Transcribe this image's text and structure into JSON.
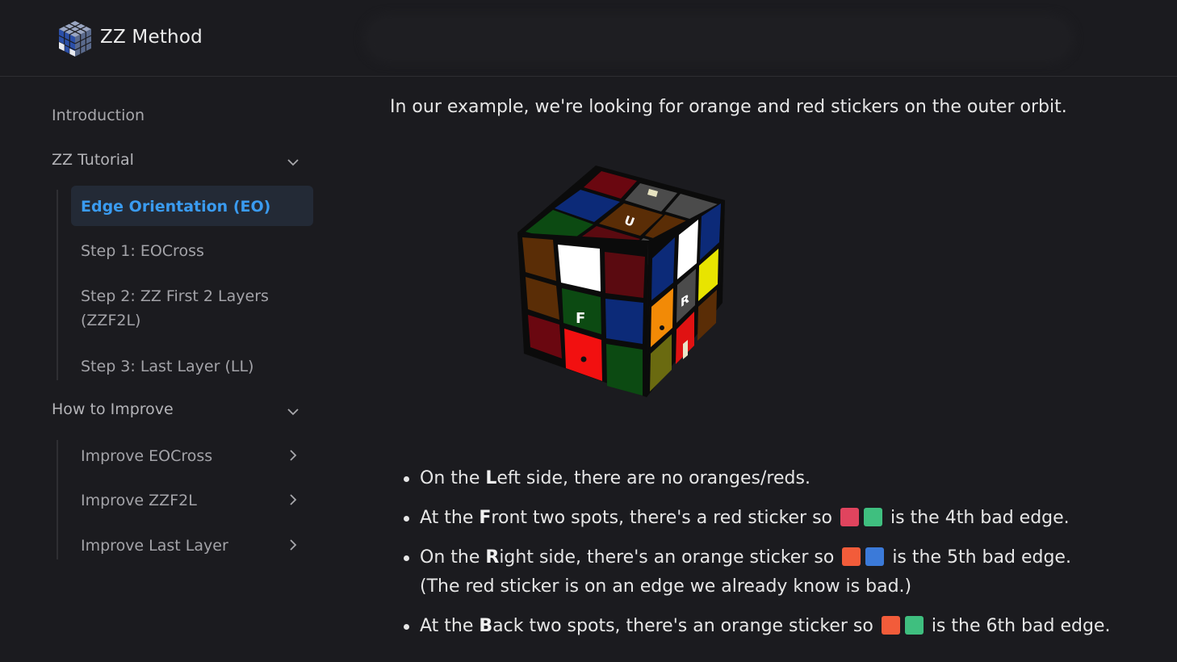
{
  "header": {
    "site_title": "ZZ Method",
    "logo_icon": "rubiks-cube-logo-icon"
  },
  "sidebar": {
    "introduction": "Introduction",
    "tutorial": {
      "label": "ZZ Tutorial",
      "items": [
        {
          "label": "Edge Orientation (EO)",
          "active": true
        },
        {
          "label": "Step 1: EOCross"
        },
        {
          "label_line1": "Step 2: ZZ First 2 Layers",
          "label_line2": "(ZZF2L)"
        },
        {
          "label": "Step 3: Last Layer (LL)"
        }
      ]
    },
    "improve": {
      "label": "How to Improve",
      "items": [
        {
          "label": "Improve EOCross"
        },
        {
          "label": "Improve ZZF2L"
        },
        {
          "label": "Improve Last Layer"
        }
      ]
    }
  },
  "main": {
    "intro_text": "In our example, we're looking for orange and red stickers on the outer orbit.",
    "cube_labels": {
      "up": "U",
      "front": "F",
      "right": "R"
    },
    "bullets": [
      {
        "prefix": "On the ",
        "bold": "L",
        "suffix": "eft side, there are no oranges/reds."
      },
      {
        "prefix": "At the ",
        "bold": "F",
        "mid": "ront two spots, there's a red sticker so",
        "end": "is the 4th bad edge.",
        "colors": [
          "#e0445e",
          "#3fbf7f"
        ]
      },
      {
        "prefix": "On the ",
        "bold": "R",
        "mid": "ight side, there's an orange sticker so",
        "end": "is the 5th bad edge.",
        "line2": "(The red sticker is on an edge we already know is bad.)",
        "colors": [
          "#f25c3a",
          "#3b7ad9"
        ]
      },
      {
        "prefix": "At the ",
        "bold": "B",
        "mid": "ack two spots, there's an orange sticker so",
        "end": "is the 6th bad edge.",
        "colors": [
          "#f25c3a",
          "#3fbf7f"
        ]
      }
    ]
  }
}
